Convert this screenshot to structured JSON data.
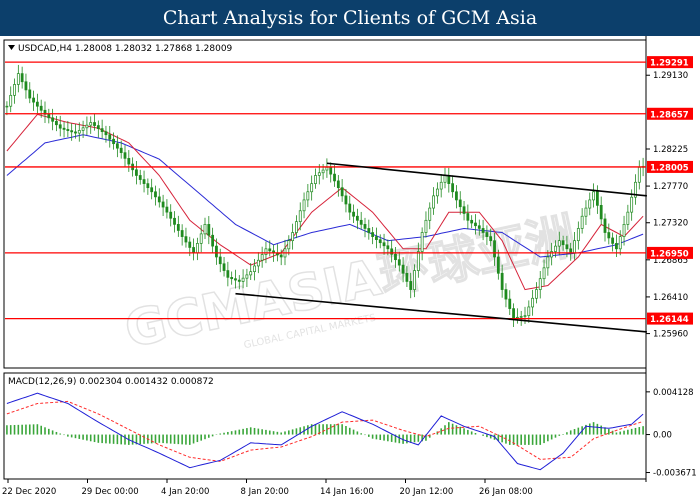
{
  "banner": {
    "title": "Chart Analysis for Clients of GCM Asia"
  },
  "watermark": {
    "text": "GCMASIA环球亚洲",
    "subtext": "GLOBAL CAPITAL MARKETS"
  },
  "colors": {
    "candle": "#1f8a1f",
    "ma_fast": "#d6233a",
    "ma_slow": "#2b2bd6",
    "level": "#ff0000",
    "trend": "#000000",
    "macd_line": "#1f1fd6",
    "signal_line": "#ff2a2a",
    "histogram": "#3aa63a",
    "level_label_bg": "#ff0000"
  },
  "chart_data": [
    {
      "type": "candlestick",
      "symbol_header": "USDCAD,H4  1.28008 1.28032 1.27868 1.28009",
      "ylim": [
        1.2555,
        1.2955
      ],
      "y_ticks": [
        "1.29130",
        "1.28225",
        "1.27770",
        "1.27320",
        "1.26865",
        "1.26410",
        "1.25960"
      ],
      "x_ticks": [
        "22 Dec 2020",
        "29 Dec 00:00",
        "4 Jan 20:00",
        "8 Jan 20:00",
        "14 Jan 16:00",
        "20 Jan 12:00",
        "26 Jan 08:00"
      ],
      "levels": [
        {
          "label": "1.29291",
          "value": 1.29291
        },
        {
          "label": "1.28657",
          "value": 1.28657
        },
        {
          "label": "1.28005",
          "value": 1.28005
        },
        {
          "label": "1.26950",
          "value": 1.2695
        },
        {
          "label": "1.26144",
          "value": 1.26144
        }
      ],
      "trendlines": [
        {
          "name": "upper",
          "from": {
            "bar": 84,
            "value": 1.2805
          },
          "to": {
            "bar": 168,
            "value": 1.2765
          }
        },
        {
          "name": "lower",
          "from": {
            "bar": 60,
            "value": 1.2645
          },
          "to": {
            "bar": 168,
            "value": 1.2598
          }
        }
      ],
      "close_path": [
        [
          0,
          1.2875
        ],
        [
          3,
          1.2915
        ],
        [
          6,
          1.2885
        ],
        [
          10,
          1.2865
        ],
        [
          14,
          1.2848
        ],
        [
          18,
          1.2842
        ],
        [
          22,
          1.2855
        ],
        [
          26,
          1.284
        ],
        [
          30,
          1.2818
        ],
        [
          34,
          1.279
        ],
        [
          38,
          1.277
        ],
        [
          42,
          1.2745
        ],
        [
          46,
          1.2715
        ],
        [
          49,
          1.2695
        ],
        [
          52,
          1.273
        ],
        [
          55,
          1.269
        ],
        [
          58,
          1.2665
        ],
        [
          61,
          1.266
        ],
        [
          64,
          1.2672
        ],
        [
          68,
          1.27
        ],
        [
          72,
          1.269
        ],
        [
          75,
          1.272
        ],
        [
          78,
          1.276
        ],
        [
          81,
          1.279
        ],
        [
          84,
          1.28
        ],
        [
          87,
          1.2775
        ],
        [
          90,
          1.2745
        ],
        [
          93,
          1.273
        ],
        [
          96,
          1.2715
        ],
        [
          100,
          1.27
        ],
        [
          103,
          1.268
        ],
        [
          106,
          1.265
        ],
        [
          109,
          1.272
        ],
        [
          112,
          1.2765
        ],
        [
          115,
          1.279
        ],
        [
          118,
          1.276
        ],
        [
          121,
          1.2735
        ],
        [
          124,
          1.2725
        ],
        [
          127,
          1.271
        ],
        [
          130,
          1.265
        ],
        [
          133,
          1.2615
        ],
        [
          136,
          1.2618
        ],
        [
          139,
          1.265
        ],
        [
          142,
          1.269
        ],
        [
          145,
          1.271
        ],
        [
          148,
          1.2695
        ],
        [
          151,
          1.274
        ],
        [
          154,
          1.277
        ],
        [
          157,
          1.272
        ],
        [
          160,
          1.27
        ],
        [
          163,
          1.2745
        ],
        [
          166,
          1.28
        ],
        [
          167,
          1.2801
        ]
      ],
      "ma_fast_path": [
        [
          0,
          1.282
        ],
        [
          8,
          1.2865
        ],
        [
          16,
          1.2855
        ],
        [
          24,
          1.2848
        ],
        [
          32,
          1.283
        ],
        [
          40,
          1.279
        ],
        [
          48,
          1.2735
        ],
        [
          56,
          1.2705
        ],
        [
          64,
          1.268
        ],
        [
          72,
          1.2695
        ],
        [
          80,
          1.2745
        ],
        [
          88,
          1.2775
        ],
        [
          96,
          1.2745
        ],
        [
          104,
          1.27
        ],
        [
          110,
          1.27
        ],
        [
          116,
          1.2745
        ],
        [
          124,
          1.2745
        ],
        [
          130,
          1.271
        ],
        [
          136,
          1.265
        ],
        [
          142,
          1.2655
        ],
        [
          150,
          1.269
        ],
        [
          156,
          1.273
        ],
        [
          162,
          1.2715
        ],
        [
          168,
          1.2745
        ]
      ],
      "ma_slow_path": [
        [
          0,
          1.279
        ],
        [
          10,
          1.283
        ],
        [
          20,
          1.284
        ],
        [
          30,
          1.283
        ],
        [
          40,
          1.281
        ],
        [
          50,
          1.277
        ],
        [
          60,
          1.273
        ],
        [
          70,
          1.2705
        ],
        [
          80,
          1.272
        ],
        [
          90,
          1.273
        ],
        [
          100,
          1.271
        ],
        [
          110,
          1.2715
        ],
        [
          120,
          1.2725
        ],
        [
          130,
          1.272
        ],
        [
          140,
          1.269
        ],
        [
          150,
          1.2695
        ],
        [
          160,
          1.2705
        ],
        [
          168,
          1.272
        ]
      ]
    },
    {
      "type": "line",
      "title": "MACD(12,26,9) 0.002304 0.001432 0.000872",
      "ylim": [
        -0.0042,
        0.0045
      ],
      "y_ticks": [
        "0.004128",
        "0.00",
        "-0.003671"
      ],
      "series": [
        {
          "name": "macd",
          "points": [
            [
              0,
              0.003
            ],
            [
              8,
              0.004
            ],
            [
              16,
              0.003
            ],
            [
              24,
              0.0012
            ],
            [
              32,
              -0.0005
            ],
            [
              40,
              -0.0018
            ],
            [
              48,
              -0.0032
            ],
            [
              56,
              -0.0025
            ],
            [
              64,
              -0.0008
            ],
            [
              72,
              -0.001
            ],
            [
              80,
              0.0008
            ],
            [
              88,
              0.0022
            ],
            [
              96,
              0.001
            ],
            [
              104,
              -0.0005
            ],
            [
              108,
              -0.001
            ],
            [
              114,
              0.0018
            ],
            [
              120,
              0.0008
            ],
            [
              128,
              -0.0002
            ],
            [
              134,
              -0.0028
            ],
            [
              140,
              -0.0034
            ],
            [
              146,
              -0.0018
            ],
            [
              152,
              0.0008
            ],
            [
              158,
              0.0006
            ],
            [
              164,
              0.001
            ],
            [
              168,
              0.0023
            ]
          ]
        },
        {
          "name": "signal",
          "points": [
            [
              0,
              0.002
            ],
            [
              8,
              0.003
            ],
            [
              16,
              0.0032
            ],
            [
              24,
              0.002
            ],
            [
              32,
              0.0005
            ],
            [
              40,
              -0.001
            ],
            [
              48,
              -0.0022
            ],
            [
              56,
              -0.0026
            ],
            [
              64,
              -0.0015
            ],
            [
              72,
              -0.0012
            ],
            [
              80,
              -0.0002
            ],
            [
              88,
              0.0012
            ],
            [
              96,
              0.0014
            ],
            [
              104,
              0.0004
            ],
            [
              110,
              -0.0002
            ],
            [
              116,
              0.0006
            ],
            [
              124,
              0.0008
            ],
            [
              132,
              -0.0006
            ],
            [
              140,
              -0.0024
            ],
            [
              148,
              -0.0022
            ],
            [
              154,
              -0.0004
            ],
            [
              160,
              0.0004
            ],
            [
              168,
              0.0014
            ]
          ]
        },
        {
          "name": "histogram",
          "points": [
            [
              0,
              0.0009
            ],
            [
              8,
              0.001
            ],
            [
              16,
              -0.0002
            ],
            [
              24,
              -0.0008
            ],
            [
              32,
              -0.001
            ],
            [
              40,
              -0.0008
            ],
            [
              48,
              -0.001
            ],
            [
              56,
              0.0001
            ],
            [
              64,
              0.0007
            ],
            [
              72,
              0.0002
            ],
            [
              80,
              0.001
            ],
            [
              88,
              0.001
            ],
            [
              96,
              -0.0004
            ],
            [
              104,
              -0.0009
            ],
            [
              110,
              -0.0006
            ],
            [
              116,
              0.0012
            ],
            [
              124,
              0.0
            ],
            [
              132,
              -0.001
            ],
            [
              140,
              -0.001
            ],
            [
              148,
              0.0004
            ],
            [
              154,
              0.0012
            ],
            [
              160,
              0.0002
            ],
            [
              168,
              0.0009
            ]
          ]
        }
      ]
    }
  ]
}
